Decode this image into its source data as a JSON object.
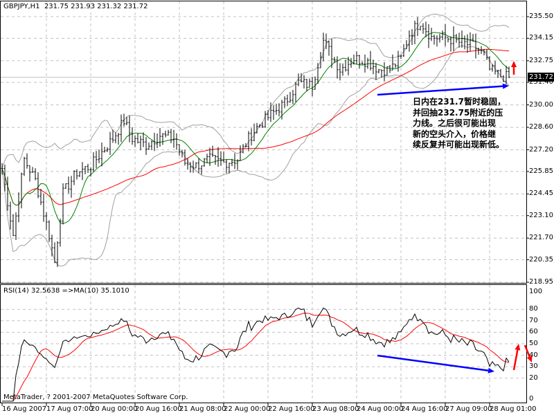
{
  "chart_data": {
    "type": "ohlc",
    "title": "GBPJPY,H1",
    "header_values": "231.75 231.93 231.32 231.72",
    "current_price": "231.72",
    "ylim": [
      218.95,
      235.5
    ],
    "y_ticks": [
      "235.50",
      "234.15",
      "232.75",
      "231.40",
      "230.00",
      "228.60",
      "227.20",
      "225.85",
      "224.45",
      "223.10",
      "221.70",
      "220.35",
      "218.95"
    ],
    "x_labels": [
      "16 Aug 2007",
      "17 Aug 07:00",
      "20 Aug 00:00",
      "20 Aug 16:00",
      "21 Aug 08:00",
      "22 Aug 00:00",
      "22 Aug 16:00",
      "23 Aug 08:00",
      "24 Aug 00:00",
      "24 Aug 16:00",
      "27 Aug 09:00",
      "28 Aug 01:00"
    ],
    "bars_per_label": 16,
    "close_anchors": [
      [
        0,
        226.05
      ],
      [
        4,
        221.9
      ],
      [
        8,
        226.6
      ],
      [
        12,
        225.3
      ],
      [
        17,
        221.9
      ],
      [
        19,
        220.2
      ],
      [
        22,
        224.5
      ],
      [
        27,
        225.8
      ],
      [
        32,
        226.2
      ],
      [
        40,
        227.9
      ],
      [
        44,
        229.0
      ],
      [
        47,
        227.9
      ],
      [
        52,
        227.5
      ],
      [
        57,
        228.1
      ],
      [
        62,
        227.9
      ],
      [
        66,
        226.4
      ],
      [
        70,
        226.2
      ],
      [
        75,
        226.6
      ],
      [
        80,
        226.4
      ],
      [
        85,
        226.6
      ],
      [
        89,
        227.9
      ],
      [
        92,
        228.6
      ],
      [
        97,
        229.4
      ],
      [
        102,
        230.1
      ],
      [
        107,
        231.4
      ],
      [
        112,
        231.2
      ],
      [
        116,
        234.0
      ],
      [
        119,
        233.1
      ],
      [
        122,
        232.2
      ],
      [
        127,
        232.9
      ],
      [
        132,
        232.7
      ],
      [
        136,
        232.2
      ],
      [
        140,
        232.2
      ],
      [
        144,
        232.9
      ],
      [
        147,
        234.4
      ],
      [
        151,
        235.2
      ],
      [
        155,
        234.2
      ],
      [
        160,
        234.2
      ],
      [
        165,
        233.9
      ],
      [
        170,
        233.7
      ],
      [
        174,
        233.1
      ],
      [
        176,
        232.2
      ],
      [
        180,
        231.8
      ],
      [
        183,
        231.72
      ]
    ],
    "indicators": {
      "ma_fast": {
        "period": 10,
        "color": "#008000"
      },
      "ma_slow": {
        "period": 50,
        "color": "#ff0000"
      },
      "bollinger": {
        "period": 20,
        "deviations": 2,
        "color": "#a0a0a0"
      }
    },
    "rsi": {
      "label": "RSI(14) 32.5638  =>MA(10) 35.1010",
      "period": 14,
      "ma_period": 10,
      "ylim": [
        0,
        100
      ],
      "y_ticks": [
        "100",
        "80",
        "70",
        "60",
        "50",
        "40",
        "30",
        "20",
        "0"
      ]
    },
    "annotation": [
      "日内在231.7暂时稳固，",
      "并回抽232.75附近的压",
      "力线。之后很可能出现",
      "新的空头介入，价格继",
      "续反复并可能出现新低。"
    ],
    "colors": {
      "bars": "#000000",
      "trendline": "#0000ff",
      "arrow": "#ff0000",
      "rsi_line": "#000000",
      "rsi_ma": "#ff0000"
    }
  },
  "footer": {
    "copyright": "MetaTrader, ? 2001-2007 MetaQuotes Software Corp."
  }
}
